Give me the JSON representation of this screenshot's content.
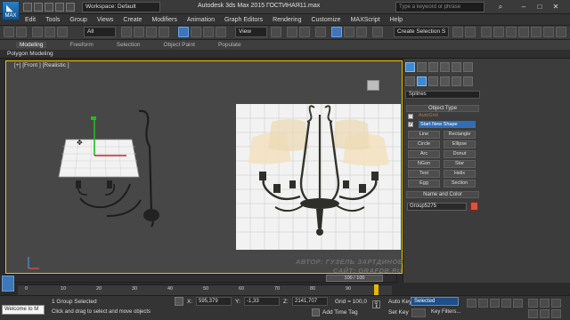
{
  "titlebar": {
    "logo_text": "MAX",
    "workspace": "Workspace: Default",
    "app_title": "Autodesk 3ds Max  2015      ГОСТИНАЯ11.max",
    "search_placeholder": "Type a keyword or phrase"
  },
  "menu": [
    "Edit",
    "Tools",
    "Group",
    "Views",
    "Create",
    "Modifiers",
    "Animation",
    "Graph Editors",
    "Rendering",
    "Customize",
    "MAXScript",
    "Help"
  ],
  "toolbar": {
    "filter_value": "All",
    "refcoord_value": "View",
    "selection_set_placeholder": "Create Selection S"
  },
  "ribbon": {
    "tabs": [
      "Modeling",
      "Freeform",
      "Selection",
      "Object Paint",
      "Populate"
    ],
    "active_tab": "Modeling",
    "sub_label": "Polygon Modeling"
  },
  "viewport": {
    "label": "[+] [Front ] [Realistic ]",
    "watermark_line1": "АВТОР: ГУЗЕЛЬ ЗАРТДИНОВА",
    "watermark_line2": "САЙТ: GRAFDB.RU"
  },
  "command_panel": {
    "category_dropdown": "Splines",
    "object_type_header": "Object Type",
    "autogrid_label": "AutoGrid",
    "start_new_shape_label": "Start New Shape",
    "buttons": [
      "Line",
      "Rectangle",
      "Circle",
      "Ellipse",
      "Arc",
      "Donut",
      "NGon",
      "Star",
      "Text",
      "Helix",
      "Egg",
      "Section"
    ],
    "name_color_header": "Name and Color",
    "object_name": "Group5275",
    "object_color": "#d9543c"
  },
  "timeline": {
    "frame_display": "100 / 100",
    "current_frame": 100,
    "total_frames": 100,
    "ticks": [
      "0",
      "10",
      "20",
      "30",
      "40",
      "50",
      "60",
      "70",
      "80",
      "90"
    ]
  },
  "status": {
    "maxscript_text": "Welcome to M",
    "selection_info": "1 Group Selected",
    "prompt": "Click and drag to select and move objects",
    "x_label": "X:",
    "x_value": "595,379",
    "y_label": "Y:",
    "y_value": "-1,33",
    "z_label": "Z:",
    "z_value": "2141,707",
    "grid": "Grid = 100,0",
    "add_time_tag": "Add Time Tag",
    "auto_key": "Auto Key",
    "set_key": "Set Key",
    "key_mode": "Selected",
    "key_filters": "Key Filters..."
  }
}
